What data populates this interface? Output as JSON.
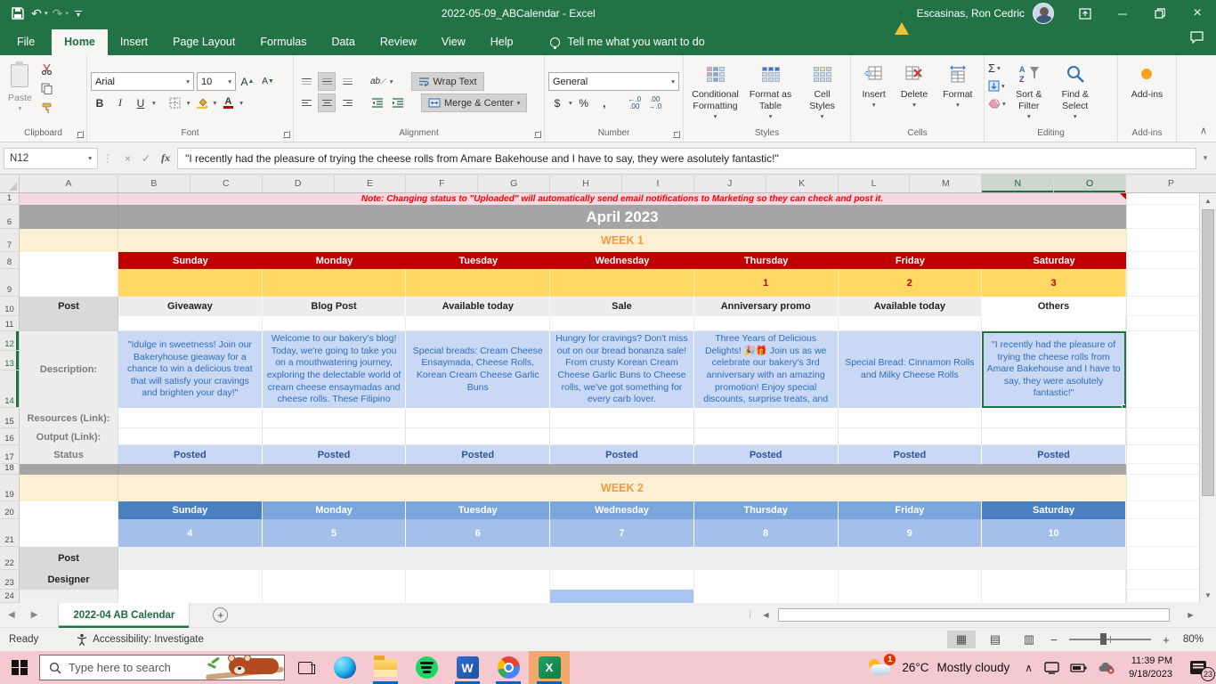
{
  "titlebar": {
    "title": "2022-05-09_ABCalendar  -  Excel",
    "user": "Escasinas, Ron Cedric"
  },
  "ribbon_tabs": {
    "file": "File",
    "tabs": [
      "Home",
      "Insert",
      "Page Layout",
      "Formulas",
      "Data",
      "Review",
      "View",
      "Help"
    ],
    "tell_me": "Tell me what you want to do"
  },
  "ribbon": {
    "clipboard": {
      "label": "Clipboard",
      "paste": "Paste"
    },
    "font": {
      "label": "Font",
      "family": "Arial",
      "size": "10",
      "bold": "B",
      "italic": "I",
      "underline": "U"
    },
    "alignment": {
      "label": "Alignment",
      "wrap_text": "Wrap Text",
      "merge_center": "Merge & Center"
    },
    "number": {
      "label": "Number",
      "format": "General",
      "currency": "$",
      "percent": "%",
      "comma": ","
    },
    "styles": {
      "label": "Styles",
      "conditional": "Conditional Formatting",
      "format_table": "Format as Table",
      "cell_styles": "Cell Styles"
    },
    "cells": {
      "label": "Cells",
      "insert": "Insert",
      "delete": "Delete",
      "format": "Format"
    },
    "editing": {
      "label": "Editing",
      "sort_filter": "Sort & Filter",
      "find_select": "Find & Select"
    },
    "addins": {
      "label": "Add-ins",
      "button": "Add-ins"
    }
  },
  "formula_bar": {
    "name_box": "N12",
    "fx": "fx",
    "value": "\"I recently had the pleasure of trying the cheese rolls from Amare Bakehouse and I have to say, they were asolutely fantastic!\""
  },
  "grid": {
    "columns": [
      "A",
      "B",
      "C",
      "D",
      "E",
      "F",
      "G",
      "H",
      "I",
      "J",
      "K",
      "L",
      "M",
      "N",
      "O",
      "P"
    ],
    "rows": [
      "1",
      "6",
      "7",
      "8",
      "9",
      "10",
      "11",
      "12",
      "13",
      "14",
      "15",
      "16",
      "17",
      "18",
      "19",
      "20",
      "21",
      "22",
      "23",
      "24"
    ]
  },
  "sheet": {
    "note": "Note: Changing status to \"Uploaded\" will automatically send email notifications to Marketing so they can check and post it.",
    "month_title": "April 2023",
    "labels": {
      "post": "Post",
      "description": "Description:",
      "resources": "Resources (Link):",
      "output": "Output (Link):",
      "status": "Status",
      "designer": "Designer"
    },
    "week1": {
      "title": "WEEK 1",
      "days": [
        "Sunday",
        "Monday",
        "Tuesday",
        "Wednesday",
        "Thursday",
        "Friday",
        "Saturday"
      ],
      "dates": [
        "",
        "",
        "",
        "",
        "1",
        "2",
        "3"
      ],
      "posts": [
        "Giveaway",
        "Blog Post",
        "Available today",
        "Sale",
        "Anniversary promo",
        "Available today",
        "Others"
      ],
      "descriptions": [
        "\"Idulge in sweetness! Join our Bakeryhouse gieaway for a chance to win a delicious treat that will satisfy your cravings and brighten your day!\"",
        "Welcome to our bakery's blog! Today, we're going to take you on a mouthwatering journey, exploring the delectable world of cream cheese ensaymadas and cheese rolls. These Filipino",
        "Special breads: Cream Cheese Ensaymada, Cheese Rolls, Korean Cream Cheese Garlic Buns",
        "Hungry for cravings? Don't miss out on our bread bonanza sale! From crusty Korean Cream Cheese Garlic Buns to Cheese rolls, we've got something for every carb lover.",
        "Three Years of Delicious Delights! 🎉🎁 Join us as we celebrate our bakery's 3rd anniversary with an amazing promotion! Enjoy special discounts, surprise treats, and",
        "Special Bread: Cinnamon Rolls and Milky Cheese Rolls",
        "\"I recently had the pleasure of trying the cheese rolls from Amare Bakehouse and I have to say, they were asolutely fantastic!\""
      ],
      "statuses": [
        "Posted",
        "Posted",
        "Posted",
        "Posted",
        "Posted",
        "Posted",
        "Posted"
      ]
    },
    "week2": {
      "title": "WEEK 2",
      "days": [
        "Sunday",
        "Monday",
        "Tuesday",
        "Wednesday",
        "Thursday",
        "Friday",
        "Saturday"
      ],
      "dates": [
        "4",
        "5",
        "6",
        "7",
        "8",
        "9",
        "10"
      ]
    }
  },
  "sheet_tabs": {
    "active": "2022-04 AB Calendar"
  },
  "status_bar": {
    "mode": "Ready",
    "accessibility": "Accessibility: Investigate",
    "zoom": "80%"
  },
  "taskbar": {
    "search_placeholder": "Type here to search",
    "weather_temp": "26°C",
    "weather_desc": "Mostly cloudy",
    "weather_badge": "1",
    "time": "11:39 PM",
    "date": "9/18/2023",
    "notification_count": "23"
  },
  "colors": {
    "excel_green": "#217346",
    "header_red": "#C00000",
    "date_yellow": "#FFD964",
    "note_pink": "#F5DAE2",
    "gray_band": "#A5A5A5",
    "week_cream": "#FCEFD4",
    "week_orange": "#EC9C40",
    "desc_bg": "#C9D9F5",
    "desc_text": "#2F6DB8",
    "posted_text": "#2F5496",
    "week2_blue_dark": "#4A7FC0",
    "week2_blue": "#7AA6DC",
    "week2_dates_blue": "#A3BFEA",
    "taskbar_pink": "#F5C9D0",
    "taskbar_highlight": "#F3A86E"
  }
}
